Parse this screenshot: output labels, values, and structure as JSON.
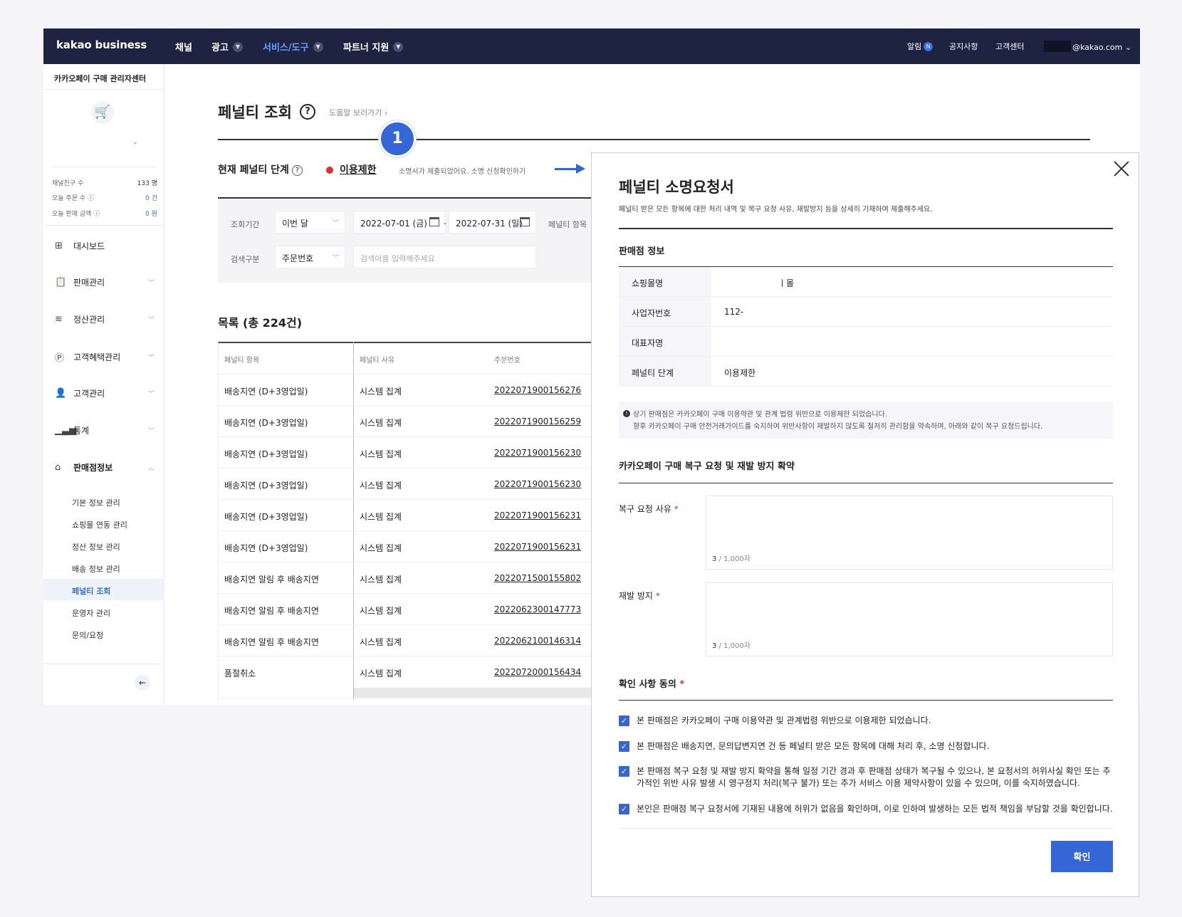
{
  "topnav": {
    "logo": "kakao business",
    "menus": [
      {
        "label": "채널",
        "has_chevron": false,
        "active": false
      },
      {
        "label": "광고",
        "has_chevron": true,
        "active": false
      },
      {
        "label": "서비스/도구",
        "has_chevron": true,
        "active": true
      },
      {
        "label": "파트너 지원",
        "has_chevron": true,
        "active": false
      }
    ],
    "right": {
      "alarm": "알림",
      "alarm_badge": "N",
      "notice": "공지사항",
      "support": "고객센터",
      "account": "@kakao.com"
    }
  },
  "sidebar": {
    "title": "카카오페이 구매 관리자센터",
    "stats": [
      {
        "label": "채널친구 수",
        "value": "133 명"
      },
      {
        "label": "오늘 주문 수",
        "value": "0 건"
      },
      {
        "label": "오늘 판매 금액",
        "value": "0 원"
      }
    ],
    "items": [
      {
        "label": "대시보드"
      },
      {
        "label": "판매관리"
      },
      {
        "label": "정산관리"
      },
      {
        "label": "고객혜택관리"
      },
      {
        "label": "고객관리"
      },
      {
        "label": "통계"
      },
      {
        "label": "판매점정보"
      }
    ],
    "subitems": [
      "기본 정보 관리",
      "쇼핑몰 연동 관리",
      "정산 정보 관리",
      "배송 정보 관리",
      "페널티 조회",
      "운영자 관리",
      "문의/요청"
    ],
    "active_sub": "페널티 조회"
  },
  "page": {
    "title": "페널티 조회",
    "help_link": "도움말 보러가기",
    "step_number": "1",
    "stage_label": "현재 페널티 단계",
    "stage_value": "이용제한",
    "stage_desc": "소명서가 제출되었어요. 소명 신청확인하기",
    "colors": {
      "accent": "#3466d8",
      "nav_bg": "#1d2340",
      "danger": "#e02d2d"
    }
  },
  "filter": {
    "period_label": "조회기간",
    "period_value": "이번 달",
    "date_from": "2022-07-01 (금)",
    "date_sep": "-",
    "date_to": "2022-07-31 (일)",
    "penalty_item_label": "페널티 항목",
    "search_type_label": "검색구분",
    "search_type_value": "주문번호",
    "search_placeholder": "검색어를 입력해주세요"
  },
  "list": {
    "title": "목록 (총 224건)",
    "columns": [
      "페널티 항목",
      "페널티 사유",
      "주문번호"
    ],
    "rows": [
      [
        "배송지연 (D+3영업일)",
        "시스템 집계",
        "2022071900156276"
      ],
      [
        "배송지연 (D+3영업일)",
        "시스템 집계",
        "2022071900156259"
      ],
      [
        "배송지연 (D+3영업일)",
        "시스템 집계",
        "2022071900156230"
      ],
      [
        "배송지연 (D+3영업일)",
        "시스템 집계",
        "2022071900156230"
      ],
      [
        "배송지연 (D+3영업일)",
        "시스템 집계",
        "2022071900156231"
      ],
      [
        "배송지연 (D+3영업일)",
        "시스템 집계",
        "2022071900156231"
      ],
      [
        "배송지연 알림 후 배송지연",
        "시스템 집계",
        "2022071500155802"
      ],
      [
        "배송지연 알림 후 배송지연",
        "시스템 집계",
        "2022062300147773"
      ],
      [
        "배송지연 알림 후 배송지연",
        "시스템 집계",
        "2022062100146314"
      ],
      [
        "품절취소",
        "시스템 집계",
        "2022072000156434"
      ]
    ]
  },
  "modal": {
    "title": "페널티 소명요청서",
    "desc": "페널티 받은 모든 항목에 대한 처리 내역 및 복구 요청 사유, 재발방지 등을 상세히 기재하여 제출해주세요.",
    "seller_section": "판매점 정보",
    "seller_info": [
      {
        "key": "쇼핑몰명",
        "value": "ㅣ몰"
      },
      {
        "key": "사업자번호",
        "value": "112-"
      },
      {
        "key": "대표자명",
        "value": ""
      },
      {
        "key": "페널티 단계",
        "value": "이용제한"
      }
    ],
    "notice_line1": "상기 판매점은 카카오페이 구매 이용약관 및 관계 법령 위반으로 이용제한 되었습니다.",
    "notice_line2": "향후 카카오페이 구매 안전거래가이드를 숙지하여 위반사항이 재발하지 않도록 철저히 관리함을 약속하며, 아래와 같이 복구 요청드립니다.",
    "restore_section": "카카오페이 구매 복구 요청 및 재발 방지 확약",
    "reason_label": "복구 요청 사유",
    "reason_count": "3",
    "reason_max": "/ 1,000자",
    "prevent_label": "재발 방지",
    "prevent_count": "3",
    "prevent_max": "/ 1,000자",
    "required_mark": "*",
    "agree_section": "확인 사항 동의",
    "agreements": [
      "본 판매점은 카카오페이 구매 이용약관 및 관계법령 위반으로 이용제한 되었습니다.",
      "본 판매점은 배송지연, 문의답변지연 건 등 페널티 받은 모든 항목에 대해 처리 후, 소명 신청합니다.",
      "본 판매점 복구 요청 및 재발 방지 확약을 통해 일정 기간 경과 후 판매점 상태가 복구될 수 있으나, 본 요청서의 허위사실 확인 또는 추가적인 위반 사유 발생 시 영구정지 처리(복구 불가) 또는 추가 서비스 이용 제약사항이 있을 수 있으며, 이를 숙지하였습니다.",
      "본인은 판매점 복구 요청서에 기재된 내용에 허위가 없음을 확인하며, 이로 인하여 발생하는 모든 법적 책임을 부담할 것을 확인합니다."
    ],
    "confirm_label": "확인"
  }
}
